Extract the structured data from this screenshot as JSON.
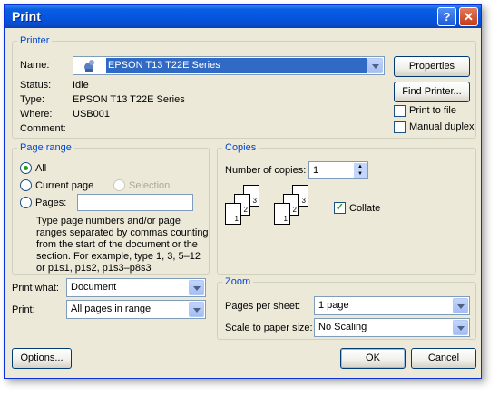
{
  "window": {
    "title": "Print",
    "help_glyph": "?",
    "close_glyph": "✕"
  },
  "printer": {
    "group_label": "Printer",
    "name_label": "Name:",
    "name_value": "EPSON T13 T22E Series",
    "status_label": "Status:",
    "status_value": "Idle",
    "type_label": "Type:",
    "type_value": "EPSON T13 T22E Series",
    "where_label": "Where:",
    "where_value": "USB001",
    "comment_label": "Comment:",
    "comment_value": "",
    "properties_button": "Properties",
    "find_printer_button": "Find Printer...",
    "print_to_file_label": "Print to file",
    "print_to_file_checked": false,
    "manual_duplex_label": "Manual duplex",
    "manual_duplex_checked": false
  },
  "page_range": {
    "group_label": "Page range",
    "all_label": "All",
    "current_page_label": "Current page",
    "selection_label": "Selection",
    "pages_label": "Pages:",
    "selected": "all",
    "pages_value": "",
    "help_line1": "Type page numbers and/or page",
    "help_line2": "ranges separated by commas counting",
    "help_line3": "from the start of the document or the",
    "help_line4": "section. For example, type 1, 3, 5–12",
    "help_line5": "or p1s1, p1s2, p1s3–p8s3"
  },
  "copies": {
    "group_label": "Copies",
    "number_label": "Number of copies:",
    "number_value": "1",
    "collate_label": "Collate",
    "collate_checked": true,
    "page_numbers": [
      "1",
      "2",
      "3"
    ]
  },
  "print_options": {
    "print_what_label": "Print what:",
    "print_what_value": "Document",
    "print_label": "Print:",
    "print_value": "All pages in range"
  },
  "zoom": {
    "group_label": "Zoom",
    "pages_per_sheet_label": "Pages per sheet:",
    "pages_per_sheet_value": "1 page",
    "scale_label": "Scale to paper size:",
    "scale_value": "No Scaling"
  },
  "buttons": {
    "options": "Options...",
    "ok": "OK",
    "cancel": "Cancel"
  }
}
